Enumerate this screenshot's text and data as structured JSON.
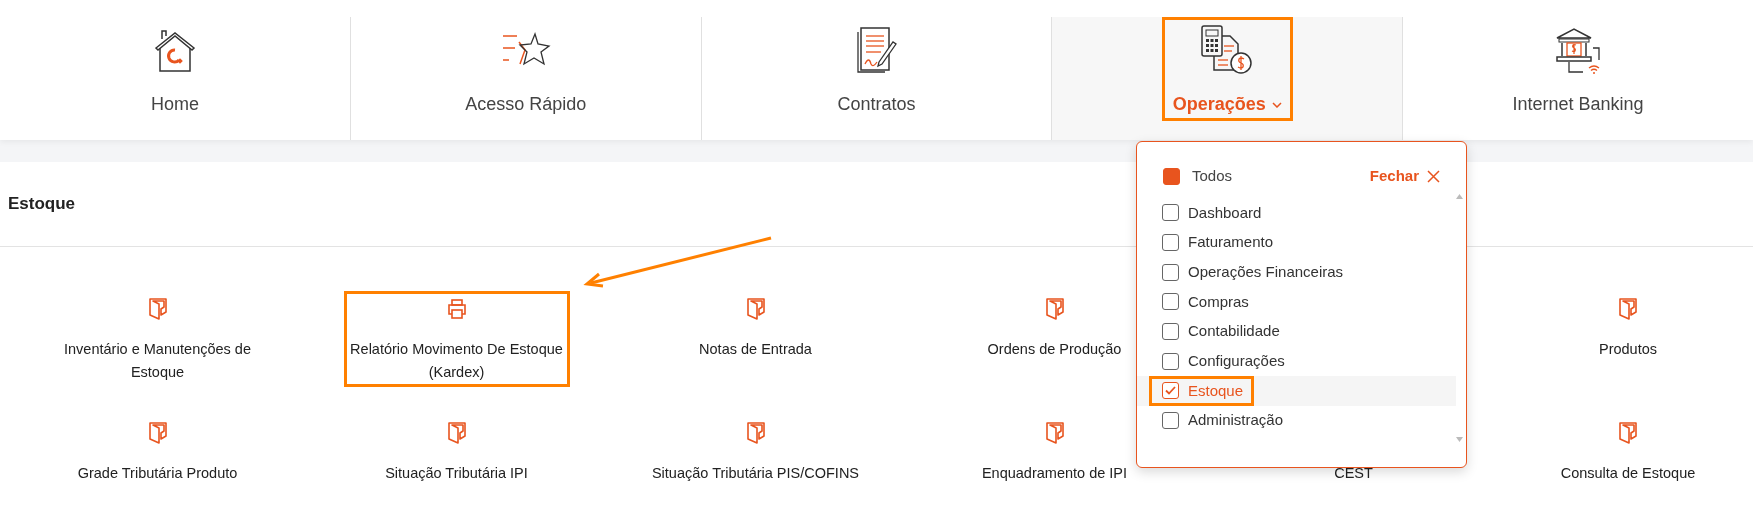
{
  "nav": [
    {
      "kind": "home",
      "label": "Home",
      "selected": false,
      "highlighted": false
    },
    {
      "kind": "star",
      "label": "Acesso Rápido",
      "selected": false,
      "highlighted": false
    },
    {
      "kind": "contract",
      "label": "Contratos",
      "selected": false,
      "highlighted": false
    },
    {
      "kind": "operations",
      "label": "Operações",
      "selected": true,
      "highlighted": true
    },
    {
      "kind": "bank",
      "label": "Internet Banking",
      "selected": false,
      "highlighted": false
    }
  ],
  "section": {
    "title": "Estoque"
  },
  "items": [
    {
      "kind": "folder",
      "label": "Inventário e Manutenções de Estoque",
      "highlighted": false
    },
    {
      "kind": "printer",
      "label": "Relatório Movimento De Estoque (Kardex)",
      "highlighted": true
    },
    {
      "kind": "folder",
      "label": "Notas de Entrada",
      "highlighted": false
    },
    {
      "kind": "folder",
      "label": "Ordens de Produção",
      "highlighted": false
    },
    {
      "kind": "hidden"
    },
    {
      "kind": "folder",
      "label": "Produtos",
      "highlighted": false
    },
    {
      "kind": "folder",
      "label": "Grade Tributária Produto",
      "highlighted": false
    },
    {
      "kind": "folder",
      "label": "Situação Tributária IPI",
      "highlighted": false
    },
    {
      "kind": "folder",
      "label": "Situação Tributária PIS/COFINS",
      "highlighted": false
    },
    {
      "kind": "folder",
      "label": "Enquadramento de IPI",
      "highlighted": false
    },
    {
      "kind": "none",
      "label": "CEST",
      "highlighted": false
    },
    {
      "kind": "folder",
      "label": "Consulta de Estoque",
      "highlighted": false
    }
  ],
  "dropdown": {
    "all": {
      "label": "Todos",
      "indeterminate": true
    },
    "close": "Fechar",
    "options": [
      {
        "label": "Dashboard",
        "checked": false,
        "selected": false,
        "highlighted": false
      },
      {
        "label": "Faturamento",
        "checked": false,
        "selected": false,
        "highlighted": false
      },
      {
        "label": "Operações Financeiras",
        "checked": false,
        "selected": false,
        "highlighted": false
      },
      {
        "label": "Compras",
        "checked": false,
        "selected": false,
        "highlighted": false
      },
      {
        "label": "Contabilidade",
        "checked": false,
        "selected": false,
        "highlighted": false
      },
      {
        "label": "Configurações",
        "checked": false,
        "selected": false,
        "highlighted": false
      },
      {
        "label": "Estoque",
        "checked": true,
        "selected": true,
        "highlighted": true
      },
      {
        "label": "Administração",
        "checked": false,
        "selected": false,
        "highlighted": false
      }
    ]
  }
}
